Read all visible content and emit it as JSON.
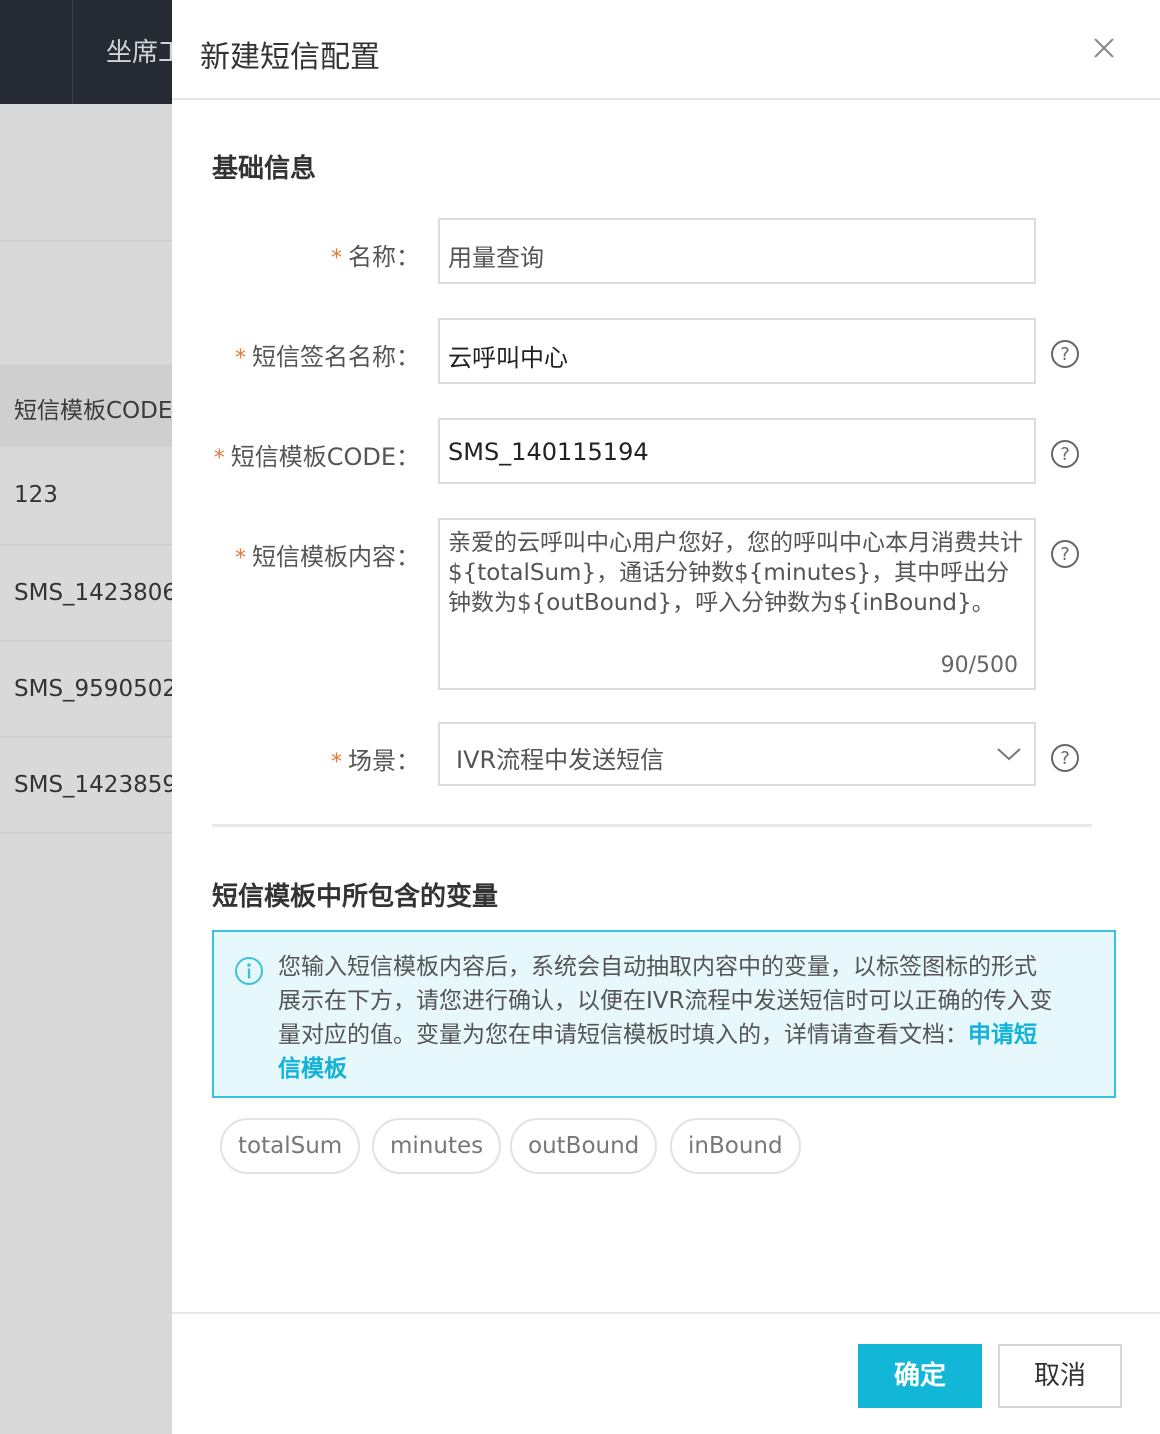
{
  "background": {
    "topbar_title": "坐席工",
    "table_header": "短信模板CODE",
    "rows": [
      "123",
      "SMS_1423806",
      "SMS_9590502",
      "SMS_1423859"
    ]
  },
  "dialog": {
    "title": "新建短信配置",
    "basic_section_title": "基础信息",
    "fields": {
      "name": {
        "label": "名称：",
        "value": "用量查询"
      },
      "sign_name": {
        "label": "短信签名名称：",
        "value": "云呼叫中心"
      },
      "template_code": {
        "label": "短信模板CODE：",
        "value": "SMS_140115194"
      },
      "template_content": {
        "label": "短信模板内容：",
        "value": "亲爱的云呼叫中心用户您好，您的呼叫中心本月消费共计${totalSum}，通话分钟数${minutes}，其中呼出分钟数为${outBound}，呼入分钟数为${inBound}。",
        "counter": "90/500"
      },
      "scene": {
        "label": "场景：",
        "value": "IVR流程中发送短信"
      }
    },
    "required_mark": "*",
    "variables_section_title": "短信模板中所包含的变量",
    "notice": {
      "text": "您输入短信模板内容后，系统会自动抽取内容中的变量，以标签图标的形式展示在下方，请您进行确认，以便在IVR流程中发送短信时可以正确的传入变量对应的值。变量为您在申请短信模板时填入的，详情请查看文档：",
      "link": "申请短信模板"
    },
    "variables": [
      "totalSum",
      "minutes",
      "outBound",
      "inBound"
    ],
    "buttons": {
      "ok": "确定",
      "cancel": "取消"
    }
  },
  "colors": {
    "accent": "#12b7d8",
    "notice_bg": "#e6f8fc",
    "notice_border": "#39c2da",
    "required": "#e07b3c"
  }
}
